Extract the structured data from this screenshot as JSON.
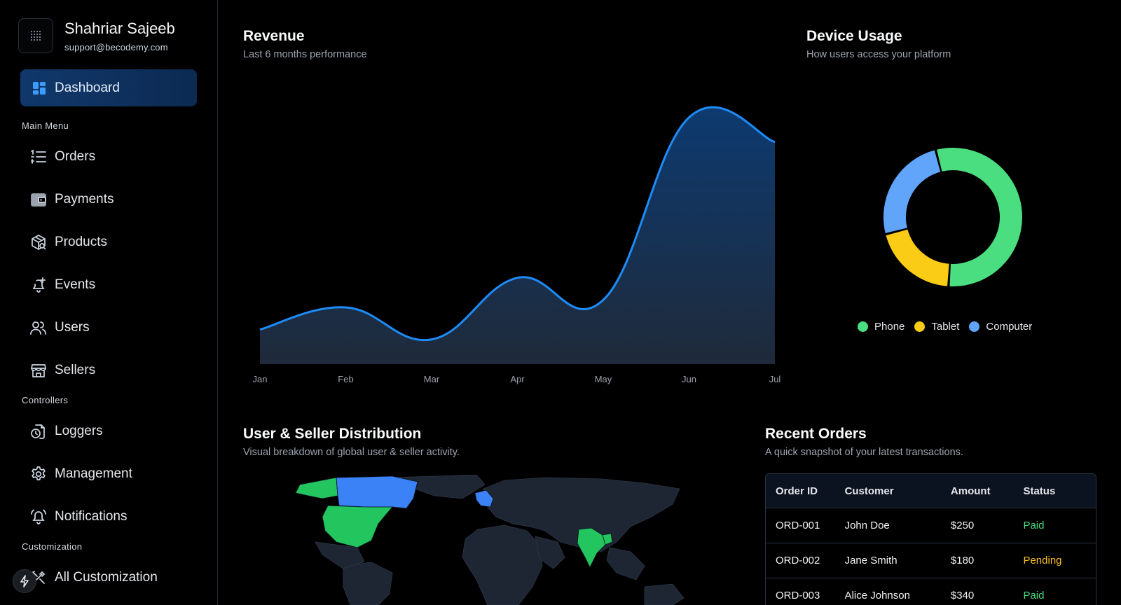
{
  "profile": {
    "name": "Shahriar Sajeeb",
    "email": "support@becodemy.com"
  },
  "sidebar": {
    "dashboard_label": "Dashboard",
    "sections": {
      "main_menu": "Main Menu",
      "controllers": "Controllers",
      "customization": "Customization"
    },
    "main_menu_items": [
      {
        "label": "Orders",
        "icon": "list-icon"
      },
      {
        "label": "Payments",
        "icon": "wallet-icon"
      },
      {
        "label": "Products",
        "icon": "package-icon"
      },
      {
        "label": "Events",
        "icon": "bell-plus-icon"
      },
      {
        "label": "Users",
        "icon": "users-icon"
      },
      {
        "label": "Sellers",
        "icon": "store-icon"
      }
    ],
    "controller_items": [
      {
        "label": "Loggers",
        "icon": "file-clock-icon"
      },
      {
        "label": "Management",
        "icon": "gear-icon"
      },
      {
        "label": "Notifications",
        "icon": "bell-ring-icon"
      }
    ],
    "customization_items": [
      {
        "label": "All Customization",
        "icon": "tools-icon"
      }
    ]
  },
  "revenue": {
    "title": "Revenue",
    "subtitle": "Last 6 months performance"
  },
  "device_usage": {
    "title": "Device Usage",
    "subtitle": "How users access your platform"
  },
  "distribution": {
    "title": "User & Seller Distribution",
    "subtitle": "Visual breakdown of global user & seller activity."
  },
  "recent_orders": {
    "title": "Recent Orders",
    "subtitle": "A quick snapshot of your latest transactions.",
    "columns": [
      "Order ID",
      "Customer",
      "Amount",
      "Status"
    ],
    "rows": [
      {
        "id": "ORD-001",
        "customer": "John Doe",
        "amount": "$250",
        "status": "Paid"
      },
      {
        "id": "ORD-002",
        "customer": "Jane Smith",
        "amount": "$180",
        "status": "Pending"
      },
      {
        "id": "ORD-003",
        "customer": "Alice Johnson",
        "amount": "$340",
        "status": "Paid"
      }
    ]
  },
  "colors": {
    "accent": "#1d8cf8",
    "phone": "#4ade80",
    "tablet": "#facc15",
    "computer": "#60a5fa",
    "paid": "#4ade80",
    "pending": "#fbbf24"
  },
  "chart_data": [
    {
      "type": "area",
      "categories": [
        "Jan",
        "Feb",
        "Mar",
        "Apr",
        "May",
        "Jun",
        "Jul"
      ],
      "values": [
        14,
        23,
        10,
        35,
        26,
        100,
        90
      ],
      "ylim": [
        0,
        105
      ],
      "grid": false
    },
    {
      "type": "pie",
      "labels": [
        "Phone",
        "Tablet",
        "Computer"
      ],
      "values": [
        55,
        20,
        25
      ],
      "legend": "bottom"
    }
  ]
}
